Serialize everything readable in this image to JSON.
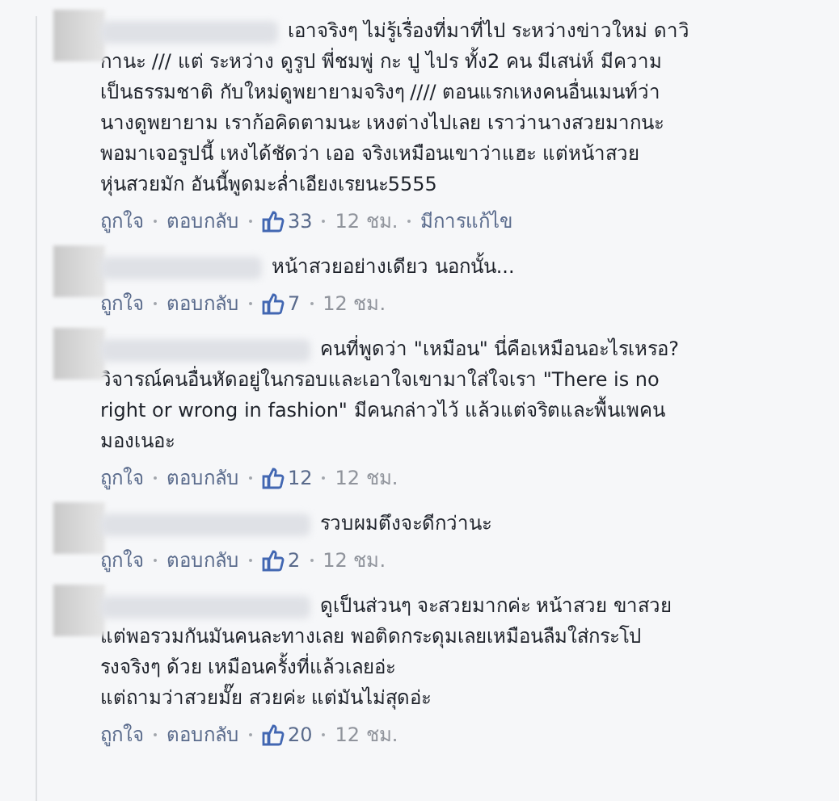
{
  "comments": [
    {
      "lines": [
        "เอาจริงๆ ไม่รู้เรื่องที่มาที่ไป ระหว่างข่าวใหม่ ดาวิ",
        "กานะ /// แต่ ระหว่าง ดูรูป พี่ชมพู่ กะ ปู ไปร ทั้ง2 คน มีเสน่ห์ มีความ",
        "เป็นธรรมชาติ กับใหม่ดูพยายามจริงๆ //// ตอนแรกเหงคนอื่นเมนท์ว่า",
        "นางดูพยายาม เราก้อคิดตามนะ เหงต่างไปเลย เราว่านางสวยมากนะ",
        "พอมาเจอรูปนี้ เหงได้ชัดว่า เออ จริงเหมือนเขาว่าแฮะ แต่หน้าสวย",
        "หุ่นสวยมัก อันนี้พูดมะล่ำเอียงเรยนะ5555"
      ],
      "like": "ถูกใจ",
      "reply": "ตอบกลับ",
      "likes": "33",
      "time": "12 ชม.",
      "edited": "มีการแก้ไข"
    },
    {
      "lines": [
        "หน้าสวยอย่างเดียว นอกนั้น..."
      ],
      "like": "ถูกใจ",
      "reply": "ตอบกลับ",
      "likes": "7",
      "time": "12 ชม."
    },
    {
      "lines": [
        "คนที่พูดว่า \"เหมือน\" นี่คือเหมือนอะไรเหรอ?",
        "วิจารณ์คนอื่นหัดอยู่ในกรอบและเอาใจเขามาใส่ใจเรา \"There is no",
        "right or wrong in fashion\" มีคนกล่าวไว้ แล้วแต่จริตและพื้นเพคน",
        "มองเนอะ"
      ],
      "like": "ถูกใจ",
      "reply": "ตอบกลับ",
      "likes": "12",
      "time": "12 ชม."
    },
    {
      "lines": [
        "รวบผมตึงจะดีกว่านะ"
      ],
      "like": "ถูกใจ",
      "reply": "ตอบกลับ",
      "likes": "2",
      "time": "12 ชม."
    },
    {
      "lines": [
        "ดูเป็นส่วนๆ จะสวยมากค่ะ หน้าสวย ขาสวย",
        "แต่พอรวมกันมันคนละทางเลย พอติดกระดุมเลยเหมือนลืมใส่กระโป",
        "รงจริงๆ ด้วย เหมือนครั้งที่แล้วเลยอ่ะ",
        "แต่ถามว่าสวยมั๊ย สวยค่ะ แต่มันไม่สุดอ่ะ"
      ],
      "like": "ถูกใจ",
      "reply": "ตอบกลับ",
      "likes": "20",
      "time": "12 ชม."
    }
  ]
}
